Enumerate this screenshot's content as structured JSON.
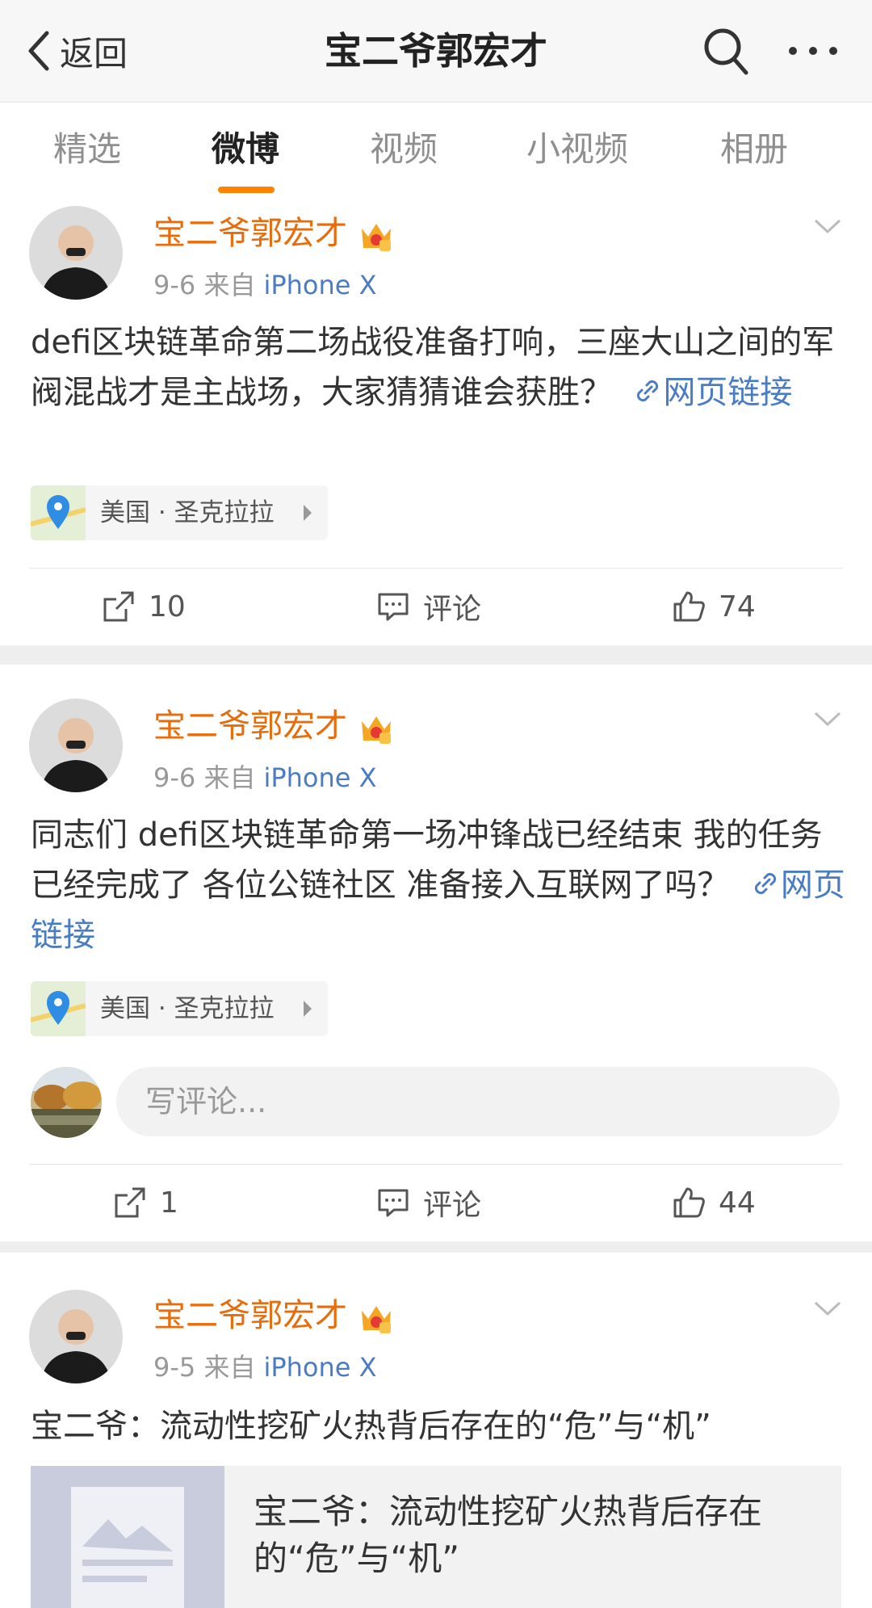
{
  "header": {
    "back_label": "返回",
    "title": "宝二爷郭宏才"
  },
  "tabs": [
    {
      "label": "精选"
    },
    {
      "label": "微博"
    },
    {
      "label": "视频"
    },
    {
      "label": "小视频"
    },
    {
      "label": "相册"
    }
  ],
  "active_tab": "微博",
  "posts": [
    {
      "username": "宝二爷郭宏才",
      "date": "9-6",
      "source_prefix": "来自",
      "source": "iPhone X",
      "text": "defi区块链革命第二场战役准备打响，三座大山之间的军阀混战才是主战场，大家猜猜谁会获胜？",
      "link_label": "网页链接",
      "location": "美国 · 圣克拉拉",
      "repost_count": "10",
      "comment_label": "评论",
      "like_count": "74"
    },
    {
      "username": "宝二爷郭宏才",
      "date": "9-6",
      "source_prefix": "来自",
      "source": "iPhone X",
      "text": "同志们 defi区块链革命第一场冲锋战已经结束 我的任务已经完成了 各位公链社区 准备接入互联网了吗？",
      "link_label": "网页链接",
      "location": "美国 · 圣克拉拉",
      "comment_placeholder": "写评论...",
      "repost_count": "1",
      "comment_label": "评论",
      "like_count": "44"
    },
    {
      "username": "宝二爷郭宏才",
      "date": "9-5",
      "source_prefix": "来自",
      "source": "iPhone X",
      "text": "宝二爷：流动性挖矿火热背后存在的“危”与“机”",
      "card_title": "宝二爷：流动性挖矿火热背后存在的“危”与“机”"
    }
  ],
  "colors": {
    "accent": "#ff8200",
    "username": "#e86c0a",
    "link": "#4a7cc4",
    "meta": "#999999"
  }
}
